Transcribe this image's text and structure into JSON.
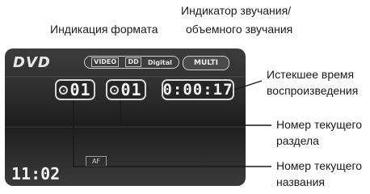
{
  "callouts": {
    "format_indicator": "Индикация формата",
    "sound_indicator_line1": "Индикатор звучания/",
    "sound_indicator_line2": "объемного звучания",
    "elapsed_line1": "Истекшее время",
    "elapsed_line2": "воспроизведения",
    "chapter_line1": "Номер текущего",
    "chapter_line2": "раздела",
    "title_line1": "Номер текущего",
    "title_line2": "названия"
  },
  "screen": {
    "logo": "DVD",
    "format": {
      "video": "VIDEO",
      "dd": "DD",
      "digital": "Digital"
    },
    "sound_mode": "MULTI",
    "title_number": "01",
    "chapter_number": "01",
    "elapsed_time": "0:00:17",
    "af_indicator": "AF",
    "clock": "11:02"
  }
}
